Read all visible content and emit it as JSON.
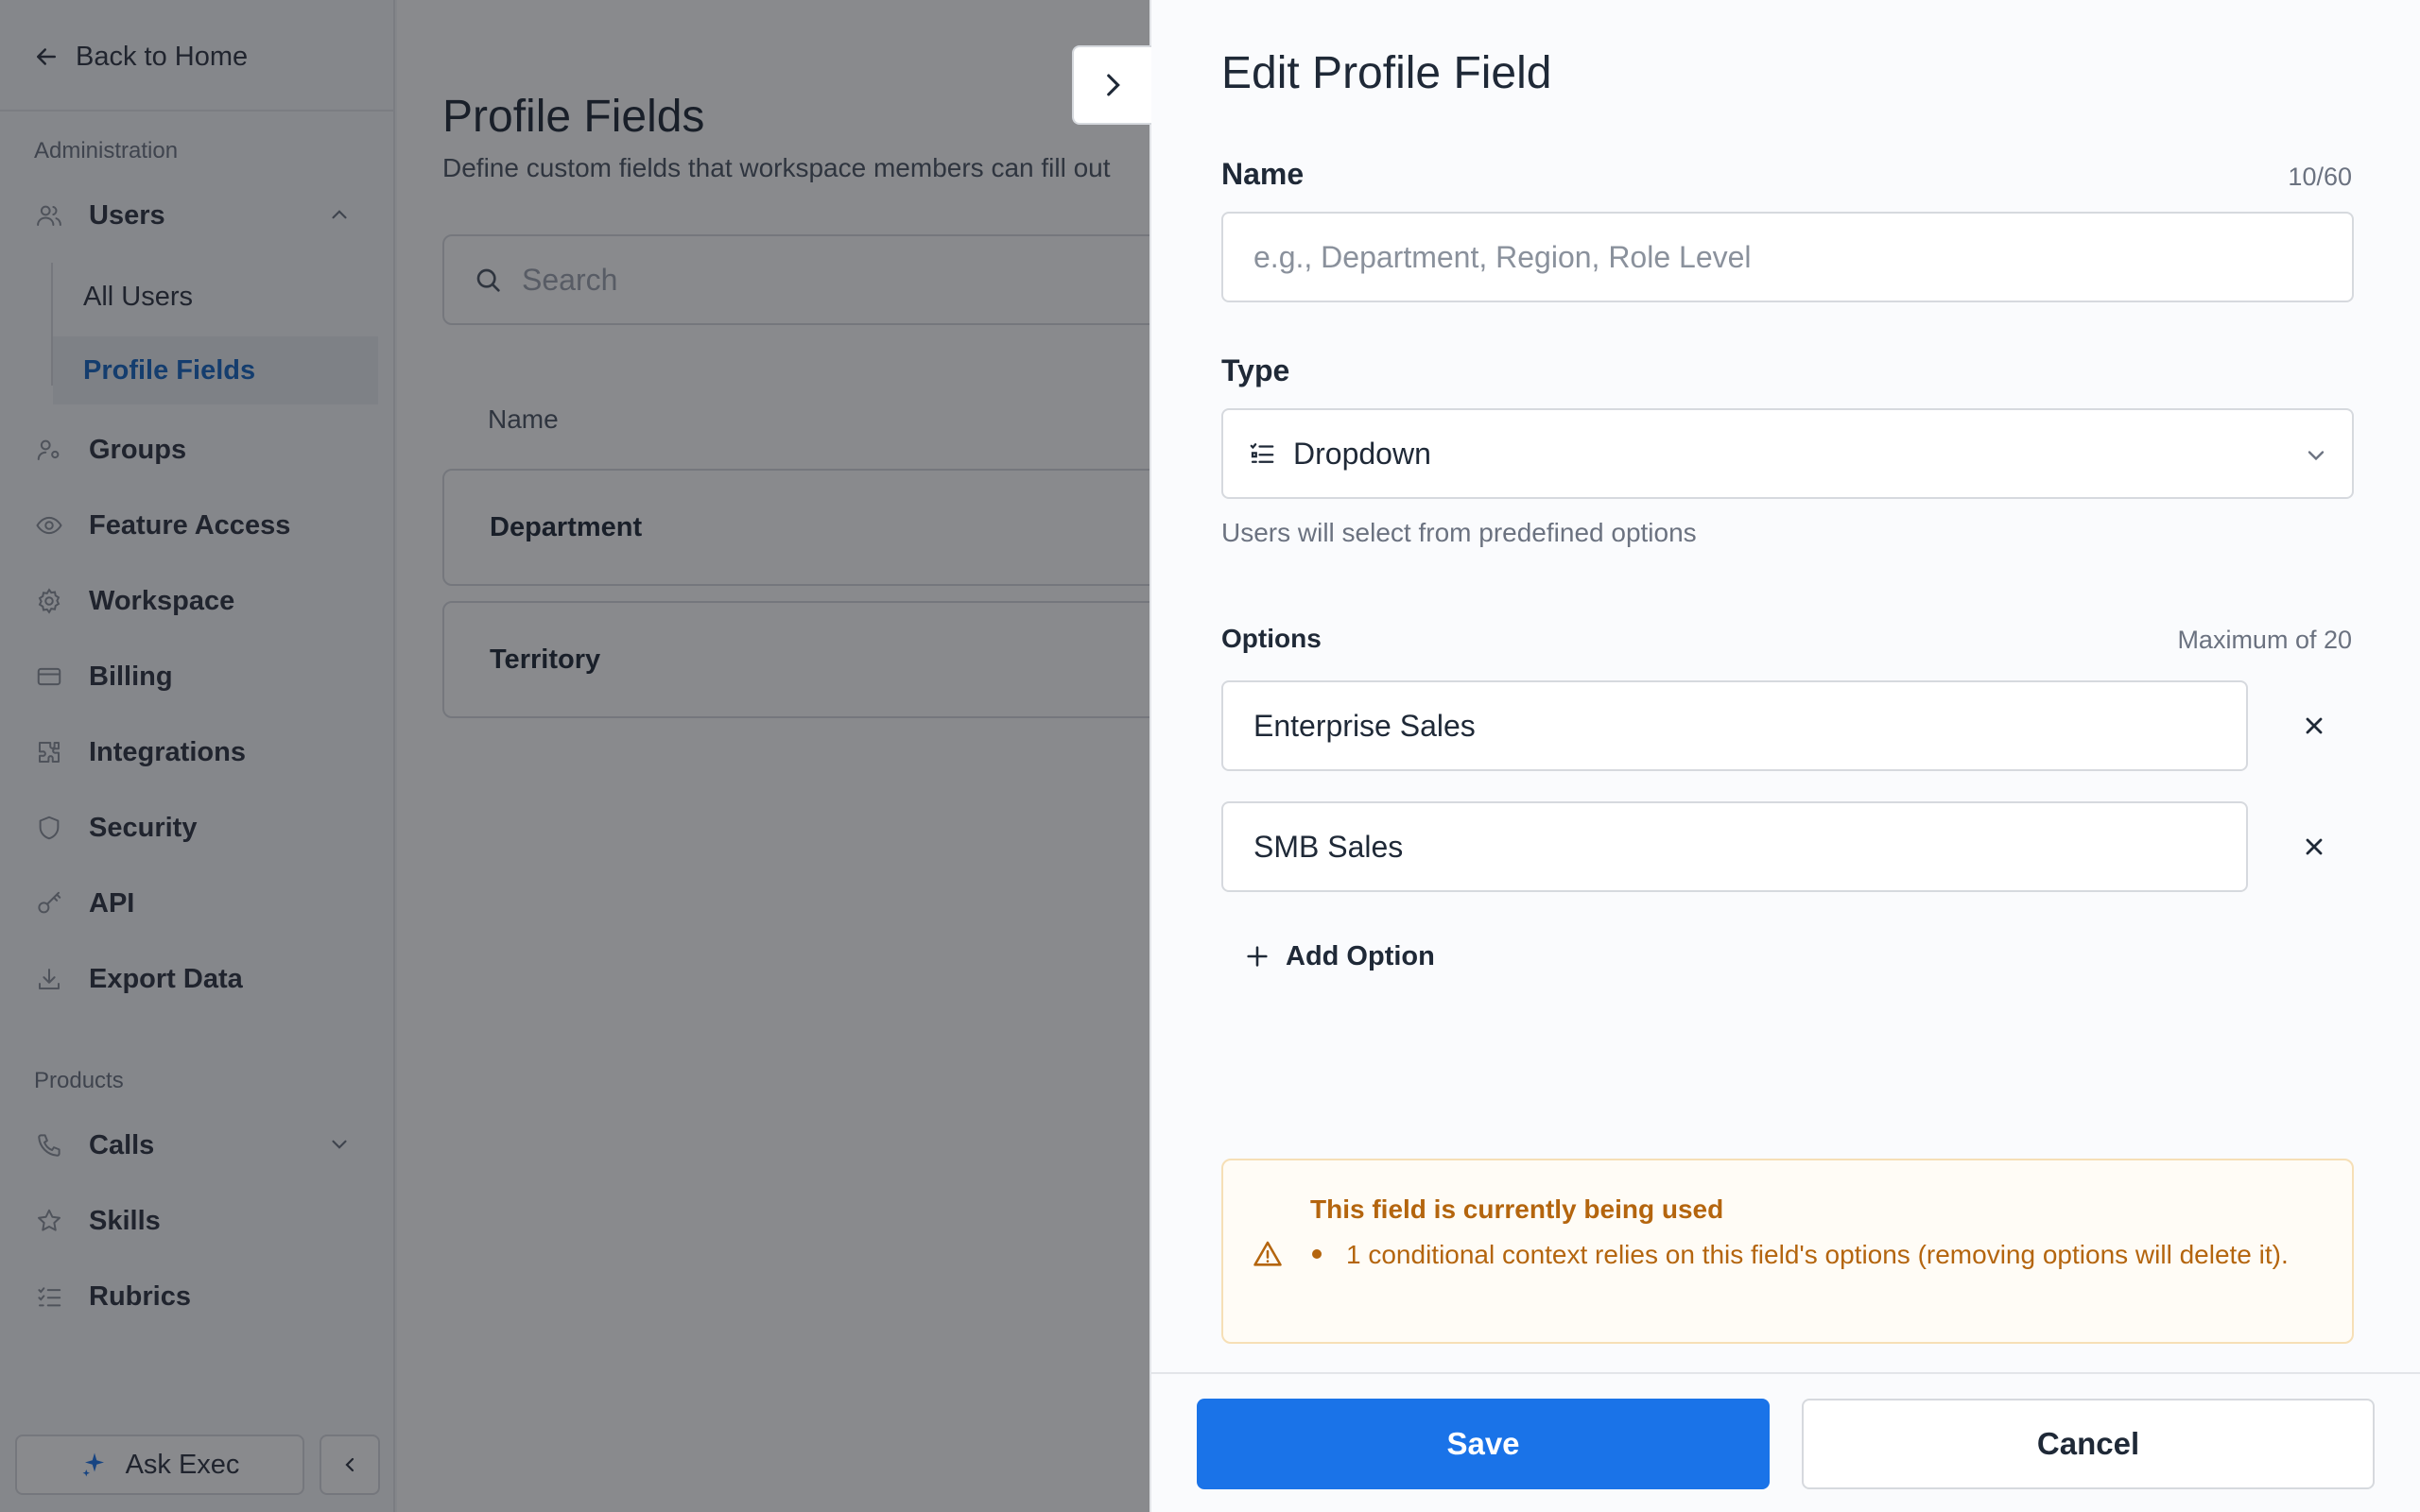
{
  "sidebar": {
    "back_label": "Back to Home",
    "section_admin": "Administration",
    "users": "Users",
    "all_users": "All Users",
    "profile_fields": "Profile Fields",
    "groups": "Groups",
    "feature_access": "Feature Access",
    "workspace": "Workspace",
    "billing": "Billing",
    "integrations": "Integrations",
    "security": "Security",
    "api": "API",
    "export_data": "Export Data",
    "section_products": "Products",
    "calls": "Calls",
    "skills": "Skills",
    "rubrics": "Rubrics",
    "ask_exec": "Ask Exec",
    "active_item": "Profile Fields"
  },
  "main": {
    "title": "Profile Fields",
    "subtitle": "Define custom fields that workspace members can fill out",
    "search_placeholder": "Search",
    "column_name": "Name",
    "rows": [
      "Department",
      "Territory"
    ]
  },
  "drawer": {
    "title": "Edit Profile Field",
    "name_label": "Name",
    "name_counter": "10/60",
    "name_placeholder": "e.g., Department, Region, Role Level",
    "type_label": "Type",
    "type_value": "Dropdown",
    "type_hint": "Users will select from predefined options",
    "options_label": "Options",
    "options_max": "Maximum of 20",
    "options": [
      "Enterprise Sales",
      "SMB Sales"
    ],
    "add_option": "Add Option",
    "warning_title": "This field is currently being used",
    "warning_item": "1 conditional context relies on this field's options (removing options will delete it).",
    "save": "Save",
    "cancel": "Cancel"
  },
  "colors": {
    "accent": "#1a73e8",
    "active_nav": "#1565c0",
    "warning_text": "#b4650e",
    "warning_border": "#f6dfb6"
  },
  "icons": {
    "back": "arrow-left-icon",
    "users": "users-icon",
    "groups": "user-group-icon",
    "feature_access": "eye-icon",
    "workspace": "gear-icon",
    "billing": "credit-card-icon",
    "integrations": "puzzle-icon",
    "security": "shield-icon",
    "api": "key-icon",
    "export_data": "download-icon",
    "calls": "phone-icon",
    "skills": "star-icon",
    "rubrics": "checklist-icon",
    "ask_exec": "sparkle-icon"
  }
}
